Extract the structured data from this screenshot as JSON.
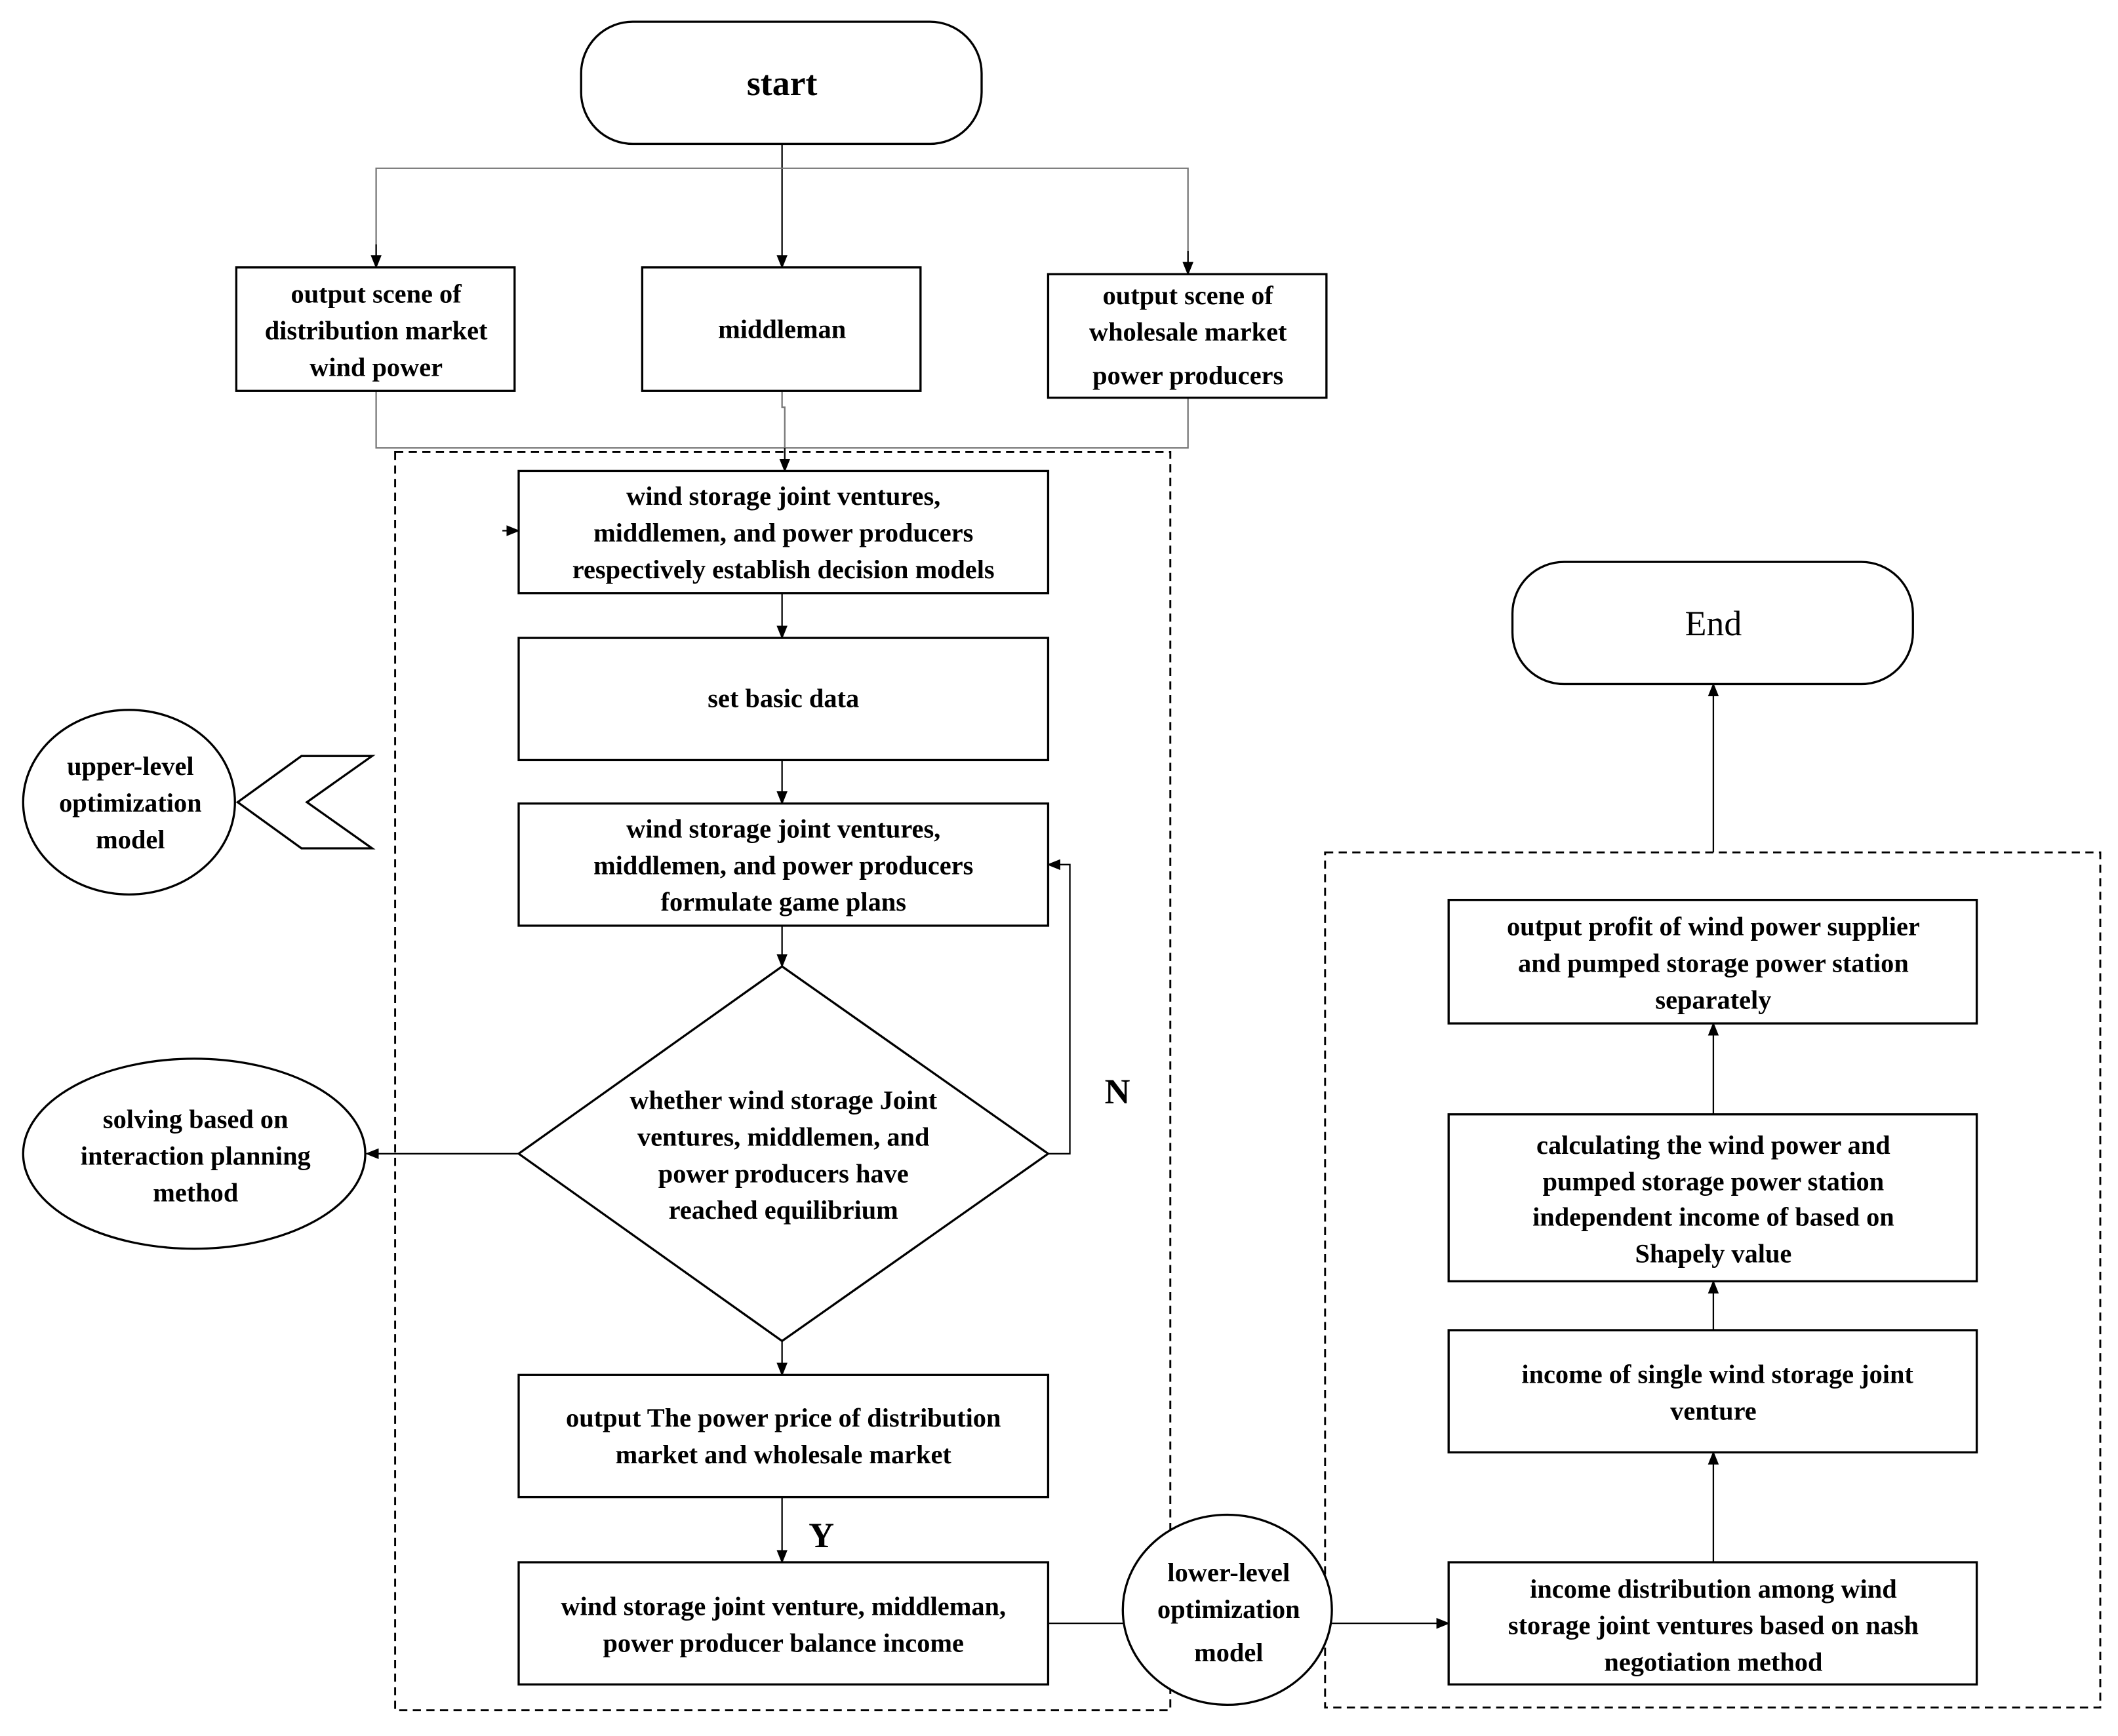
{
  "nodes": {
    "start": {
      "lines": [
        "start"
      ]
    },
    "distribution_wind": {
      "lines": [
        "output scene of",
        "distribution market",
        "wind power"
      ]
    },
    "middleman": {
      "lines": [
        "middleman"
      ]
    },
    "wholesale_producers": {
      "lines": [
        "output scene of",
        "wholesale market",
        "power  producers"
      ]
    },
    "decision_models": {
      "lines": [
        "wind storage joint ventures,",
        "middlemen, and power producers",
        "respectively establish decision models"
      ]
    },
    "basic_data": {
      "lines": [
        "set basic data"
      ]
    },
    "game_plans": {
      "lines": [
        "wind storage joint ventures,",
        "middlemen, and power producers",
        "formulate game plans"
      ]
    },
    "equilibrium": {
      "lines": [
        "whether wind storage Joint",
        "ventures, middlemen, and",
        "power producers have",
        "reached equilibrium"
      ]
    },
    "power_price": {
      "lines": [
        "output The power price of  distribution",
        "market and wholesale market"
      ]
    },
    "balance_income": {
      "lines": [
        "wind storage joint venture, middleman,",
        "power producer balance income"
      ]
    },
    "upper_level": {
      "lines": [
        "upper-level",
        "optimization",
        "model"
      ]
    },
    "solving": {
      "lines": [
        "solving based on",
        "interaction planning",
        "method"
      ]
    },
    "lower_level": {
      "lines": [
        "lower-level",
        "optimization",
        "model"
      ]
    },
    "nash": {
      "lines": [
        "income distribution among wind",
        "storage joint ventures based on nash",
        "negotiation method"
      ]
    },
    "single_income": {
      "lines": [
        "income of single wind storage joint",
        "venture"
      ]
    },
    "shapely": {
      "lines": [
        "calculating the wind power and",
        "pumped storage power station",
        "independent income of based on",
        "Shapely value"
      ]
    },
    "output_profit": {
      "lines": [
        "output profit of wind power supplier",
        "and pumped storage power station",
        "separately"
      ]
    },
    "end": {
      "lines": [
        "End"
      ]
    }
  },
  "edge_labels": {
    "no": "N",
    "yes": "Y"
  }
}
